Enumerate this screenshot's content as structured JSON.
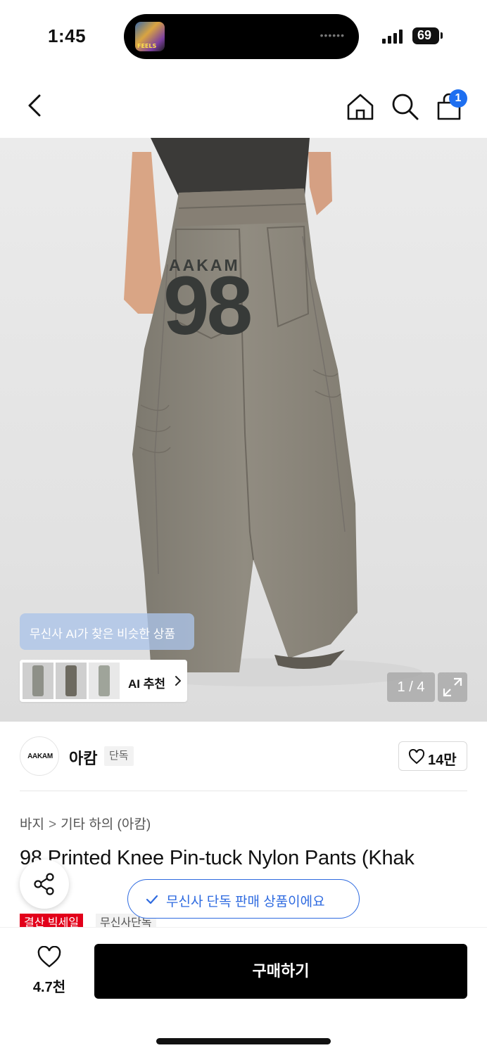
{
  "status_bar": {
    "time": "1:45",
    "battery": "69",
    "now_playing_art_label": "FEELS"
  },
  "header": {
    "cart_badge": "1",
    "icons": [
      "back-icon",
      "home-icon",
      "search-icon",
      "cart-icon"
    ]
  },
  "gallery": {
    "ai_tip": "무신사 AI가 찾은 비슷한 상품",
    "ai_button_label": "AI 추천",
    "counter": "1 / 4",
    "print_brand": "AAKAM",
    "print_number": "98",
    "thumb_colors": [
      "#8e9088",
      "#6d6a60",
      "#9fa49a"
    ]
  },
  "brand": {
    "logo_text": "AAKAM",
    "name": "아캄",
    "tag": "단독",
    "likes": "14만"
  },
  "product": {
    "breadcrumb": [
      "바지",
      "기타 하의 (아캄)"
    ],
    "title": "98 Printed Knee Pin-tuck Nylon Pants (Khak",
    "exclusive_notice": "무신사 단독 판매 상품이에요",
    "tags": [
      "결산 빅세일",
      "무신사단독"
    ]
  },
  "bottom_bar": {
    "wish_count": "4.7천",
    "buy_label": "구매하기"
  },
  "colors": {
    "accent_blue": "#2f6be0",
    "sale_red": "#e2001a",
    "pants_khaki": "#8a857a"
  }
}
